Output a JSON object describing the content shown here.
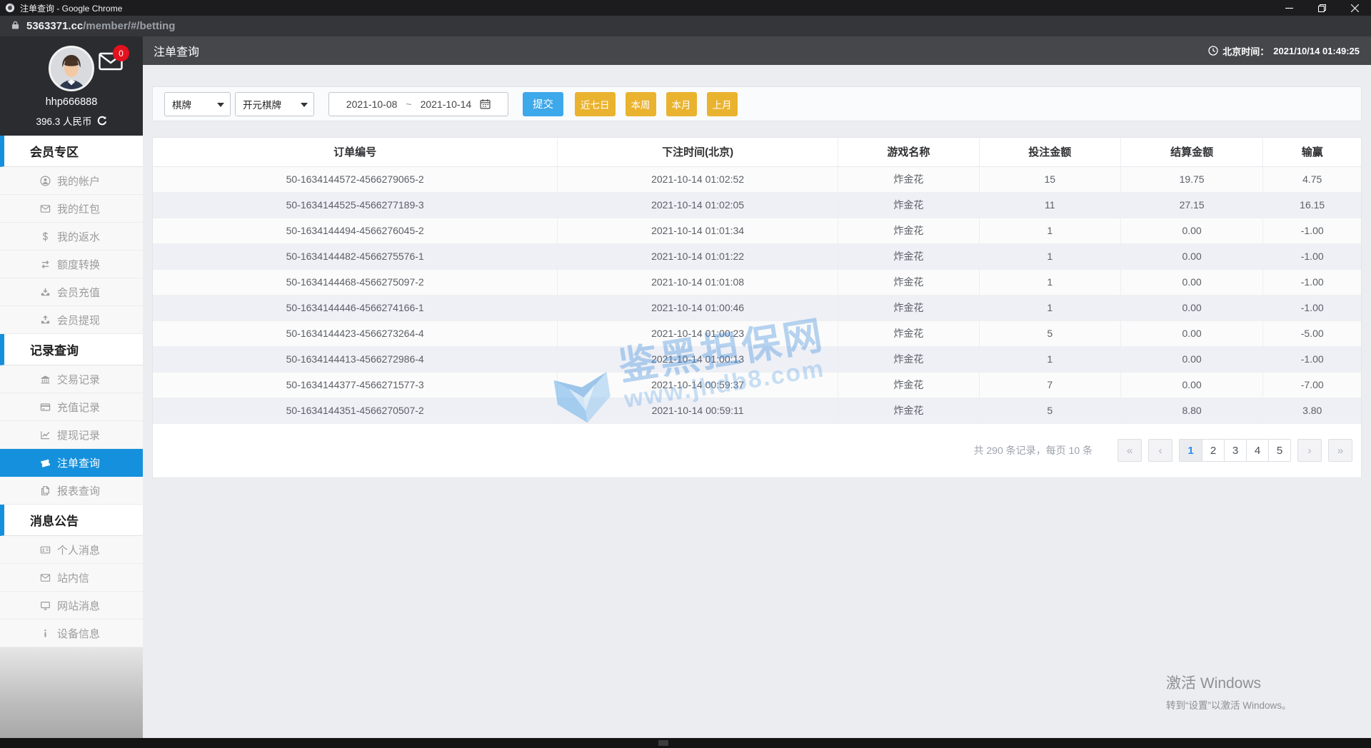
{
  "window": {
    "title": "注单查询 - Google Chrome",
    "url_host": "5363371.cc",
    "url_path": "/member/#/betting"
  },
  "header": {
    "title": "注单查询",
    "time_label": "北京时间：",
    "time_value": "2021/10/14 01:49:25"
  },
  "user": {
    "name": "hhp666888",
    "balance": "396.3 人民币",
    "mail_badge": "0"
  },
  "sidebar": {
    "sections": [
      {
        "label": "会员专区",
        "items": [
          {
            "icon": "user",
            "label": "我的帐户"
          },
          {
            "icon": "packet",
            "label": "我的红包"
          },
          {
            "icon": "dollar",
            "label": "我的返水"
          },
          {
            "icon": "exchange",
            "label": "额度转换"
          },
          {
            "icon": "deposit",
            "label": "会员充值"
          },
          {
            "icon": "withdraw",
            "label": "会员提现"
          }
        ]
      },
      {
        "label": "记录查询",
        "items": [
          {
            "icon": "bank",
            "label": "交易记录"
          },
          {
            "icon": "card",
            "label": "充值记录"
          },
          {
            "icon": "chart",
            "label": "提现记录"
          },
          {
            "icon": "ticket",
            "label": "注单查询",
            "active": true
          },
          {
            "icon": "report",
            "label": "报表查询"
          }
        ]
      },
      {
        "label": "消息公告",
        "items": [
          {
            "icon": "idcard",
            "label": "个人消息"
          },
          {
            "icon": "mailo",
            "label": "站内信"
          },
          {
            "icon": "monitor",
            "label": "网站消息"
          },
          {
            "icon": "info",
            "label": "设备信息"
          }
        ]
      }
    ]
  },
  "filters": {
    "game_type": "棋牌",
    "platform": "开元棋牌",
    "date_from": "2021-10-08",
    "date_sep": "~",
    "date_to": "2021-10-14",
    "submit": "提交",
    "quick": [
      "近七日",
      "本周",
      "本月",
      "上月"
    ]
  },
  "table": {
    "columns": [
      "订单编号",
      "下注时间(北京)",
      "游戏名称",
      "投注金额",
      "结算金额",
      "输赢"
    ],
    "col_widths": [
      "33.5%",
      "23.2%",
      "11.7%",
      "11.7%",
      "11.8%",
      "8.1%"
    ],
    "rows": [
      [
        "50-1634144572-4566279065-2",
        "2021-10-14 01:02:52",
        "炸金花",
        "15",
        "19.75",
        "4.75"
      ],
      [
        "50-1634144525-4566277189-3",
        "2021-10-14 01:02:05",
        "炸金花",
        "11",
        "27.15",
        "16.15"
      ],
      [
        "50-1634144494-4566276045-2",
        "2021-10-14 01:01:34",
        "炸金花",
        "1",
        "0.00",
        "-1.00"
      ],
      [
        "50-1634144482-4566275576-1",
        "2021-10-14 01:01:22",
        "炸金花",
        "1",
        "0.00",
        "-1.00"
      ],
      [
        "50-1634144468-4566275097-2",
        "2021-10-14 01:01:08",
        "炸金花",
        "1",
        "0.00",
        "-1.00"
      ],
      [
        "50-1634144446-4566274166-1",
        "2021-10-14 01:00:46",
        "炸金花",
        "1",
        "0.00",
        "-1.00"
      ],
      [
        "50-1634144423-4566273264-4",
        "2021-10-14 01:00:23",
        "炸金花",
        "5",
        "0.00",
        "-5.00"
      ],
      [
        "50-1634144413-4566272986-4",
        "2021-10-14 01:00:13",
        "炸金花",
        "1",
        "0.00",
        "-1.00"
      ],
      [
        "50-1634144377-4566271577-3",
        "2021-10-14 00:59:37",
        "炸金花",
        "7",
        "0.00",
        "-7.00"
      ],
      [
        "50-1634144351-4566270507-2",
        "2021-10-14 00:59:11",
        "炸金花",
        "5",
        "8.80",
        "3.80"
      ]
    ]
  },
  "pagination": {
    "summary": "共 290 条记录，每页 10 条",
    "first": "«",
    "prev": "‹",
    "pages": [
      "1",
      "2",
      "3",
      "4",
      "5"
    ],
    "active_page": "1",
    "next": "›",
    "last": "»"
  },
  "watermark": {
    "line1": "鉴黑担保网",
    "line2": "www.jhdb8.com"
  },
  "activation": {
    "line1": "激活 Windows",
    "line2": "转到“设置”以激活 Windows。"
  },
  "colors": {
    "accent_blue": "#1590dc",
    "submit_blue": "#3da8ea",
    "quick_yellow": "#eab32f",
    "active_page_blue": "#2d8cf0",
    "badge_red": "#e4111f"
  }
}
